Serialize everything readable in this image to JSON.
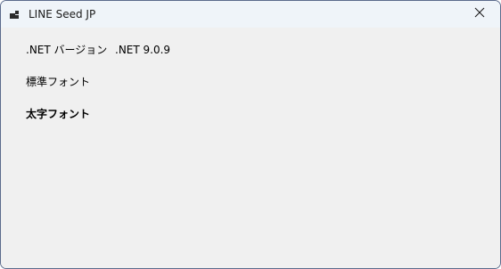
{
  "window": {
    "title": "LINE Seed JP",
    "icon": "app-window-icon",
    "close_icon": "close-icon"
  },
  "content": {
    "version_label": ".NET バージョン",
    "version_value": ".NET 9.0.9",
    "regular_font_label": "標準フォント",
    "bold_font_label": "太字フォント"
  }
}
